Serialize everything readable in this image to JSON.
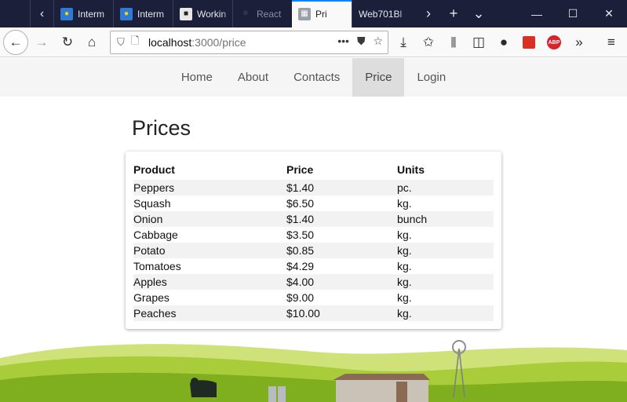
{
  "browser": {
    "tabs": [
      {
        "title": "Interm",
        "icon": "blue-favicon-icon"
      },
      {
        "title": "Interm",
        "icon": "blue-favicon-icon"
      },
      {
        "title": "Workin",
        "icon": "dark-favicon-icon"
      },
      {
        "title": "React",
        "icon": "react-favicon-icon"
      },
      {
        "title": "Pri",
        "icon": "gray-favicon-icon",
        "active": true
      },
      {
        "title": "Web701Bl",
        "icon": ""
      }
    ],
    "url_host": "localhost",
    "url_path": ":3000/price",
    "url_more": "•••"
  },
  "sitenav": {
    "links": [
      "Home",
      "About",
      "Contacts",
      "Price",
      "Login"
    ],
    "active": "Price"
  },
  "page": {
    "title": "Prices",
    "table": {
      "headers": [
        "Product",
        "Price",
        "Units"
      ],
      "rows": [
        [
          "Peppers",
          "$1.40",
          "pc."
        ],
        [
          "Squash",
          "$6.50",
          "kg."
        ],
        [
          "Onion",
          "$1.40",
          "bunch"
        ],
        [
          "Cabbage",
          "$3.50",
          "kg."
        ],
        [
          "Potato",
          "$0.85",
          "kg."
        ],
        [
          "Tomatoes",
          "$4.29",
          "kg."
        ],
        [
          "Apples",
          "$4.00",
          "kg."
        ],
        [
          "Grapes",
          "$9.00",
          "kg."
        ],
        [
          "Peaches",
          "$10.00",
          "kg."
        ]
      ]
    }
  },
  "colors": {
    "tabstrip": "#1b1f3a",
    "accent": "#0a84ff",
    "nav_bg": "#f5f5f5",
    "nav_active": "#dddddd"
  }
}
